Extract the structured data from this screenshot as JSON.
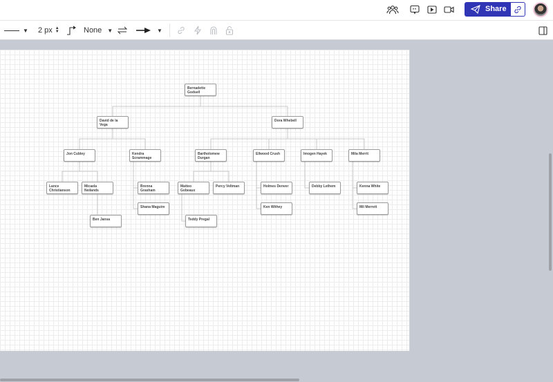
{
  "topbar": {
    "share_label": "Share",
    "icons": [
      "collaborators-icon",
      "comment-icon",
      "present-icon",
      "video-icon",
      "send-icon",
      "link-icon",
      "avatar"
    ]
  },
  "toolbar": {
    "line_style": "line-style",
    "stroke_width": "2 px",
    "line_start": "None",
    "colors": {
      "accent": "#3035b5"
    }
  },
  "org_chart": {
    "nodes": {
      "n1": "Bernadette Godsell",
      "n2": "David de la Vega",
      "n3": "Dora Whebell",
      "n4": "Jon Cubley",
      "n5": "Kendra Scrammage",
      "n6": "Bartholomew Durgan",
      "n7": "Ellwood Crush",
      "n8": "Imogen Hayek",
      "n9": "Mila Merrit",
      "n10": "Lance Christianson",
      "n11": "Micaela Neilands",
      "n12": "Brenna Grasham",
      "n13": "Shana Maguire",
      "n14": "Matteo Gobeaux",
      "n15": "Percy Veltman",
      "n16": "Holmes Denver",
      "n17": "Ken Withey",
      "n18": "Debby Lethem",
      "n19": "Kenna White",
      "n20": "Mil Merrett",
      "n21": "Ben Jansa",
      "n22": "Teddy Pregal"
    }
  }
}
